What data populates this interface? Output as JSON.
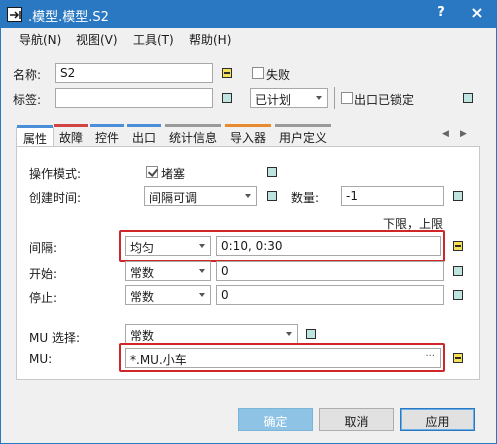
{
  "window": {
    "title": ".模型.模型.S2",
    "help_label": "?",
    "close_label": "×"
  },
  "menu": [
    {
      "label": "导航(N)"
    },
    {
      "label": "视图(V)"
    },
    {
      "label": "工具(T)"
    },
    {
      "label": "帮助(H)"
    }
  ],
  "header": {
    "name_label": "名称:",
    "name_value": "S2",
    "failed_label": "失败",
    "tag_label": "标签:",
    "tag_value": "",
    "plan_value": "已计划",
    "exit_locked_label": "出口已锁定"
  },
  "tabs": [
    {
      "label": "属性",
      "color": "#4a8fd8"
    },
    {
      "label": "故障",
      "color": "#d24444"
    },
    {
      "label": "控件",
      "color": "#4a8fd8"
    },
    {
      "label": "出口",
      "color": "#4a8fd8"
    },
    {
      "label": "统计信息",
      "color": "#9a9a9a"
    },
    {
      "label": "导入器",
      "color": "#e88a2e"
    },
    {
      "label": "用户定义",
      "color": "#9a9a9a"
    }
  ],
  "tab_nav": {
    "prev": "◀",
    "next": "▶"
  },
  "props": {
    "op_mode_label": "操作模式:",
    "blocked_label": "堵塞",
    "blocked_checked": true,
    "create_time_label": "创建时间:",
    "create_time_value": "间隔可调",
    "count_label": "数量:",
    "count_value": "-1",
    "limits_label": "下限，上限",
    "interval_label": "间隔:",
    "interval_dist": "均匀",
    "interval_value": "0:10, 0:30",
    "start_label": "开始:",
    "start_dist": "常数",
    "start_value": "0",
    "stop_label": "停止:",
    "stop_dist": "常数",
    "stop_value": "0",
    "mu_select_label": "MU 选择:",
    "mu_select_value": "常数",
    "mu_label": "MU:",
    "mu_value": "*.MU.小车",
    "mu_browse": "···"
  },
  "buttons": {
    "ok": "确定",
    "cancel": "取消",
    "apply": "应用"
  },
  "colors": {
    "titlebar": "#2b78c2",
    "highlight": "#d0262a",
    "attr_teal": "#bfe3df",
    "attr_yellow": "#f5e05a"
  }
}
